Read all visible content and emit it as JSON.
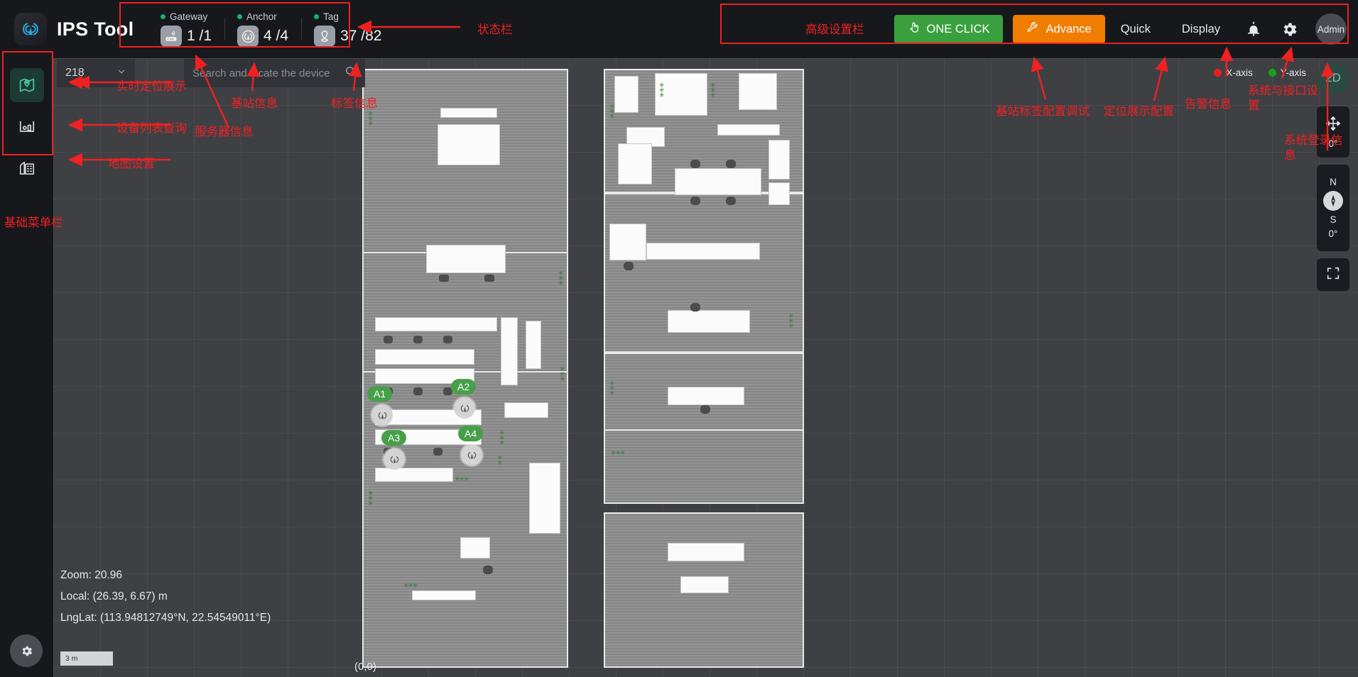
{
  "app": {
    "title": "IPS Tool",
    "logo_icon": "signal-tower-icon"
  },
  "status_bar": {
    "items": [
      {
        "label": "Gateway",
        "icon": "router-icon",
        "value": "1 /1",
        "dot_color": "#19b36a"
      },
      {
        "label": "Anchor",
        "icon": "anchor-antenna-icon",
        "value": "4 /4",
        "dot_color": "#19b36a"
      },
      {
        "label": "Tag",
        "icon": "tag-pin-icon",
        "value": "37 /82",
        "dot_color": "#19b36a"
      }
    ]
  },
  "toolbar": {
    "one_click_label": "ONE CLICK",
    "one_click_icon": "hand-click-icon",
    "one_click_color": "#3aa03e",
    "advance_label": "Advance",
    "advance_icon": "wrench-icon",
    "advance_color": "#f07c00",
    "quick_label": "Quick",
    "display_label": "Display",
    "alarm_icon": "alarm-bell-icon",
    "settings_icon": "gear-icon",
    "user_label": "Admin",
    "user_icon": "avatar-icon"
  },
  "sidebar": {
    "items": [
      {
        "name": "realtime-positioning",
        "icon": "location-pin-map-icon",
        "active": true
      },
      {
        "name": "device-list",
        "icon": "device-list-icon",
        "active": false
      },
      {
        "name": "map-settings",
        "icon": "building-map-icon",
        "active": false
      }
    ],
    "bottom_gear_icon": "gear-icon"
  },
  "map": {
    "floor_selector": {
      "value": "218",
      "chevron_icon": "chevron-down-icon"
    },
    "search": {
      "placeholder": "Search and locate the device",
      "value": "",
      "icon": "search-icon"
    },
    "axis_legend": [
      {
        "label": "X-axis",
        "color": "#e81e1e"
      },
      {
        "label": "Y-axis",
        "color": "#17a317"
      }
    ],
    "controls": {
      "view_mode": "2D",
      "pan_icon": "move-arrows-icon",
      "pan_angle": "0°",
      "compass_north": "N",
      "compass_south": "S",
      "compass_angle": "0°",
      "compass_icon": "compass-needle-icon",
      "fullscreen_icon": "fullscreen-icon"
    },
    "info": {
      "zoom": "Zoom:  20.96",
      "local": "Local:  (26.39,  6.67)  m",
      "lnglat": "LngLat:  (113.94812749°N,  22.54549011°E)"
    },
    "scale_label": "3 m",
    "origin_label": "(0,0)",
    "anchors": [
      {
        "label": "A1",
        "icon": "anchor-antenna-icon"
      },
      {
        "label": "A2",
        "icon": "anchor-antenna-icon"
      },
      {
        "label": "A3",
        "icon": "anchor-antenna-icon"
      },
      {
        "label": "A4",
        "icon": "anchor-antenna-icon"
      }
    ]
  },
  "annotations": {
    "status_bar": "状态栏",
    "advanced_settings": "高级设置栏",
    "realtime_display": "实时定位展示",
    "device_list_query": "设备列表查询",
    "map_settings": "地图设置",
    "base_menu_bar": "基础菜单栏",
    "server_info": "服务器信息",
    "anchor_info": "基站信息",
    "tag_info": "标签信息",
    "anchor_tag_config": "基站标签配置调试",
    "positioning_display_config": "定位展示配置",
    "alarm_info": "告警信息",
    "system_interface_config": "系统与接口设置",
    "system_login_info": "系统登录信息"
  }
}
